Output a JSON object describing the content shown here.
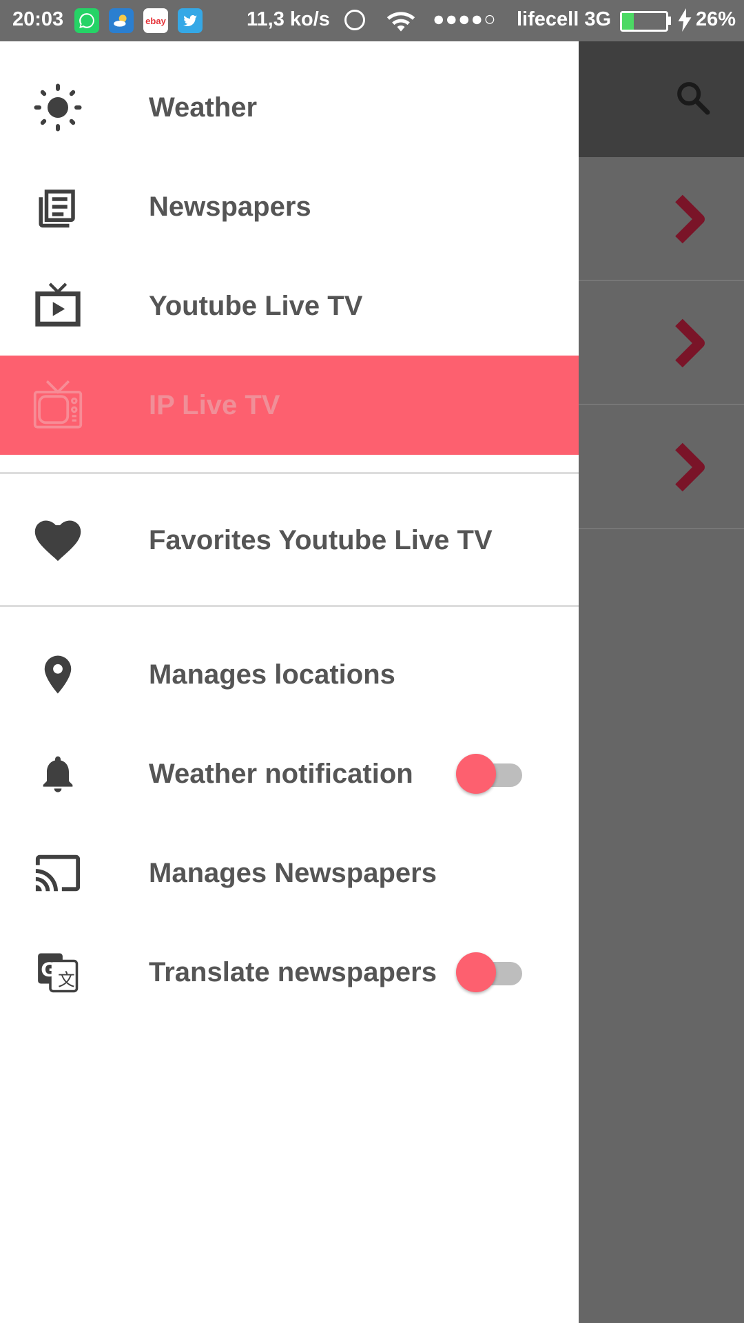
{
  "status_bar": {
    "time": "20:03",
    "apps": [
      {
        "icon": "whatsapp-icon",
        "color": "#25d366",
        "text": ""
      },
      {
        "icon": "weather-app-icon",
        "color": "#2b7fd0",
        "text": ""
      },
      {
        "icon": "ebay-icon",
        "color": "#ffffff",
        "text": "ebay"
      },
      {
        "icon": "twitter-icon",
        "color": "#35a8e6",
        "text": ""
      }
    ],
    "speed": "11,3 ko/s",
    "signal": "●●●●○",
    "carrier": "lifecell 3G",
    "battery_level": 0.26,
    "battery_percent": "26%"
  },
  "drawer": {
    "items": [
      {
        "id": "weather",
        "label": "Weather",
        "icon": "sun-icon"
      },
      {
        "id": "newspapers",
        "label": "Newspapers",
        "icon": "newspaper-icon"
      },
      {
        "id": "youtube-live-tv",
        "label": "Youtube Live TV",
        "icon": "live-tv-icon"
      },
      {
        "id": "ip-live-tv",
        "label": "IP Live TV",
        "icon": "tv-icon",
        "active": true
      },
      {
        "id": "favorites-youtube-live-tv",
        "label": "Favorites Youtube Live TV",
        "icon": "heart-icon"
      },
      {
        "id": "manages-locations",
        "label": "Manages locations",
        "icon": "location-pin-icon"
      },
      {
        "id": "weather-notification",
        "label": "Weather notification",
        "icon": "bell-icon",
        "toggle": "on"
      },
      {
        "id": "manages-newspapers",
        "label": "Manages Newspapers",
        "icon": "cast-icon"
      },
      {
        "id": "translate-newspapers",
        "label": "Translate newspapers",
        "icon": "translate-icon",
        "toggle": "on"
      }
    ]
  },
  "colors": {
    "accent": "#fd606f",
    "chevron": "#7a1428",
    "icon": "#404040",
    "label": "#555555"
  }
}
